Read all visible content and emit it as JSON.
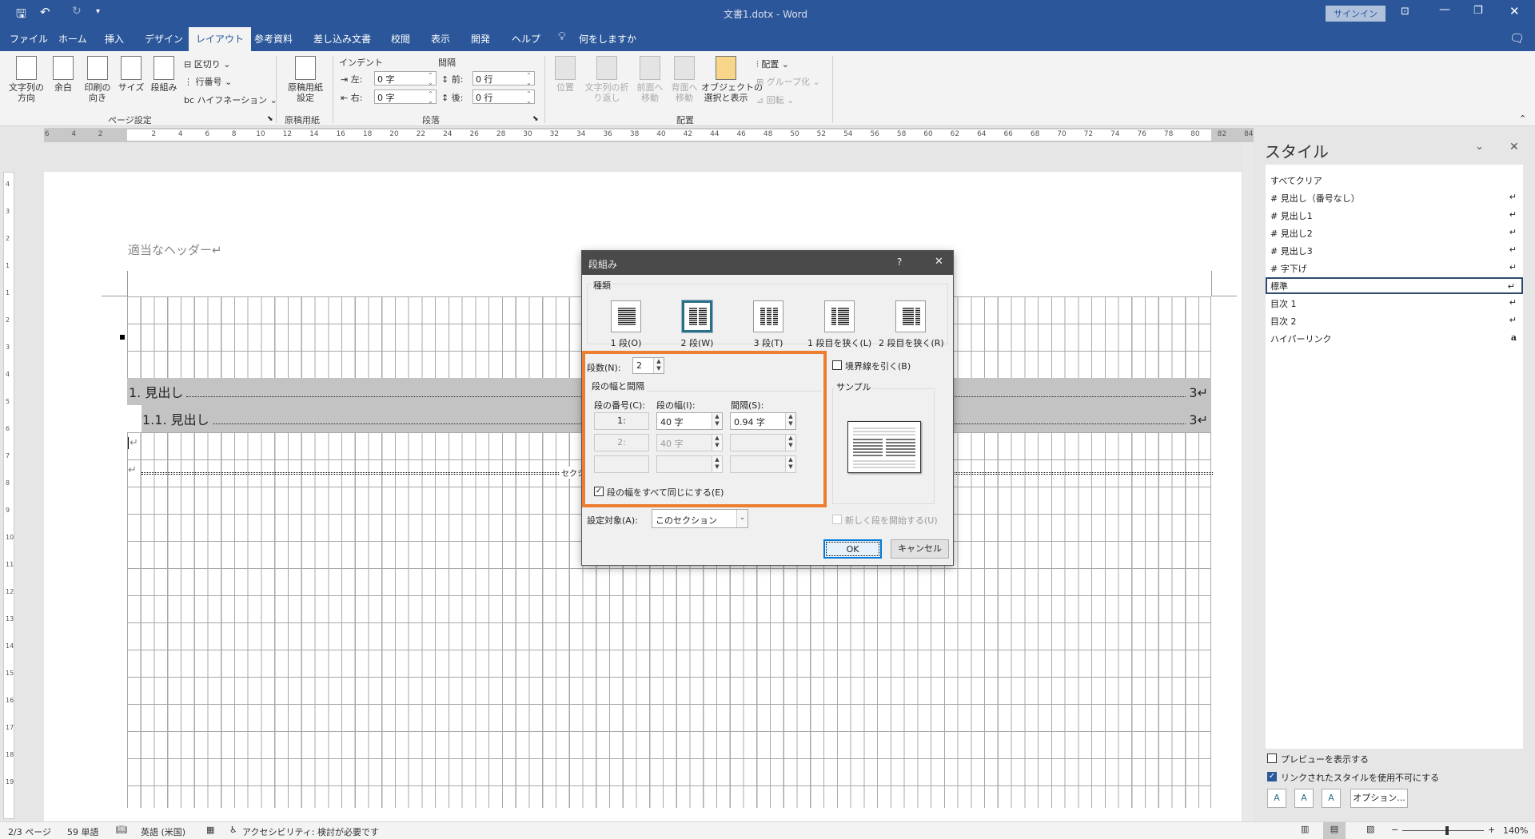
{
  "titlebar": {
    "title": "文書1.dotx  -  Word",
    "signin": "サインイン",
    "qat_more": "▾"
  },
  "tabs": [
    "ファイル",
    "ホーム",
    "挿入",
    "デザイン",
    "レイアウト",
    "参考資料",
    "差し込み文書",
    "校閲",
    "表示",
    "開発",
    "ヘルプ"
  ],
  "tell_me": "何をしますか",
  "ribbon": {
    "page_setup": {
      "text_direction": "文字列の\n方向",
      "margins": "余白",
      "orientation": "印刷の\n向き",
      "size": "サイズ",
      "columns": "段組み",
      "breaks": "区切り",
      "line_numbers": "行番号",
      "hyphenation": "ハイフネーション",
      "label": "ページ設定"
    },
    "genko": {
      "button": "原稿用紙\n設定",
      "label": "原稿用紙"
    },
    "paragraph": {
      "indent": "インデント",
      "spacing": "間隔",
      "left": "左:",
      "right": "右:",
      "before": "前:",
      "after": "後:",
      "left_val": "0 字",
      "right_val": "0 字",
      "before_val": "0 行",
      "after_val": "0 行",
      "label": "段落"
    },
    "arrange": {
      "position": "位置",
      "wrap": "文字列の折\nり返し",
      "forward": "前面へ\n移動",
      "backward": "背面へ\n移動",
      "selection_pane": "オブジェクトの\n選択と表示",
      "align": "配置",
      "group": "グループ化",
      "rotate": "回転",
      "label": "配置"
    }
  },
  "ruler": {
    "labels": [
      "6",
      "4",
      "2",
      "2",
      "4",
      "6",
      "8",
      "10",
      "12",
      "14",
      "16",
      "18",
      "20",
      "22",
      "24",
      "26",
      "28",
      "30",
      "32",
      "34",
      "36",
      "38",
      "40",
      "42",
      "44",
      "46",
      "48",
      "50",
      "52",
      "54",
      "56",
      "58",
      "60",
      "62",
      "64",
      "66",
      "68",
      "70",
      "72",
      "74",
      "76",
      "78",
      "80",
      "82",
      "84"
    ]
  },
  "vruler": {
    "labels": [
      "4",
      "3",
      "2",
      "1",
      "1",
      "2",
      "3",
      "4",
      "5",
      "6",
      "7",
      "8",
      "9",
      "10",
      "11",
      "12",
      "13",
      "14",
      "15",
      "16",
      "17",
      "18",
      "19"
    ]
  },
  "document": {
    "header": "適当なヘッダー↵",
    "toc": [
      {
        "text": "1. 見出し",
        "page": "3↵"
      },
      {
        "text": "1.1. 見出し",
        "page": "3↵"
      }
    ],
    "para_mark": "↵",
    "section_break": "セクシ"
  },
  "dialog": {
    "title": "段組み",
    "help": "?",
    "close": "✕",
    "presets_label": "種類",
    "presets": [
      "1 段(O)",
      "2 段(W)",
      "3 段(T)",
      "1 段目を狭く(L)",
      "2 段目を狭く(R)"
    ],
    "selected_preset": "2 段(W)",
    "num_columns_label": "段数(N):",
    "num_columns": "2",
    "line_between": "境界線を引く(B)",
    "line_between_checked": false,
    "width_spacing_label": "段の幅と間隔",
    "col_header": "段の番号(C):",
    "width_header": "段の幅(I):",
    "spacing_header": "間隔(S):",
    "rows": [
      {
        "col": "1:",
        "width": "40 字",
        "spacing": "0.94 字"
      },
      {
        "col": "2:",
        "width": "40 字",
        "spacing": ""
      },
      {
        "col": "",
        "width": "",
        "spacing": ""
      }
    ],
    "equal_width": "段の幅をすべて同じにする(E)",
    "equal_width_checked": true,
    "sample_label": "サンプル",
    "apply_to_label": "設定対象(A):",
    "apply_to": "このセクション",
    "new_column": "新しく段を開始する(U)",
    "ok": "OK",
    "cancel": "キャンセル",
    "highlight_color": "#ed7d31"
  },
  "styles_pane": {
    "title": "スタイル",
    "items": [
      {
        "name": "すべてクリア",
        "mark": ""
      },
      {
        "name": "# 見出し（番号なし）",
        "mark": "↵"
      },
      {
        "name": "# 見出し1",
        "mark": "↵"
      },
      {
        "name": "# 見出し2",
        "mark": "↵"
      },
      {
        "name": "# 見出し3",
        "mark": "↵"
      },
      {
        "name": "# 字下げ",
        "mark": "↵"
      },
      {
        "name": "標準",
        "mark": "↵"
      },
      {
        "name": "目次 1",
        "mark": "↵"
      },
      {
        "name": "目次 2",
        "mark": "↵"
      },
      {
        "name": "ハイパーリンク",
        "mark": "a"
      }
    ],
    "selected": "標準",
    "show_preview": "プレビューを表示する",
    "show_preview_checked": false,
    "disable_linked": "リンクされたスタイルを使用不可にする",
    "disable_linked_checked": true,
    "options": "オプション..."
  },
  "statusbar": {
    "page": "2/3 ページ",
    "words": "59 単語",
    "language": "英語 (米国)",
    "accessibility": "アクセシビリティ: 検討が必要です",
    "zoom": "140%",
    "zoom_minus": "−",
    "zoom_plus": "+",
    "zoom_level_percent": 140
  },
  "colors": {
    "brand": "#2b579a",
    "dialog_title": "#4a4a4a",
    "highlight": "#ed7d31"
  }
}
